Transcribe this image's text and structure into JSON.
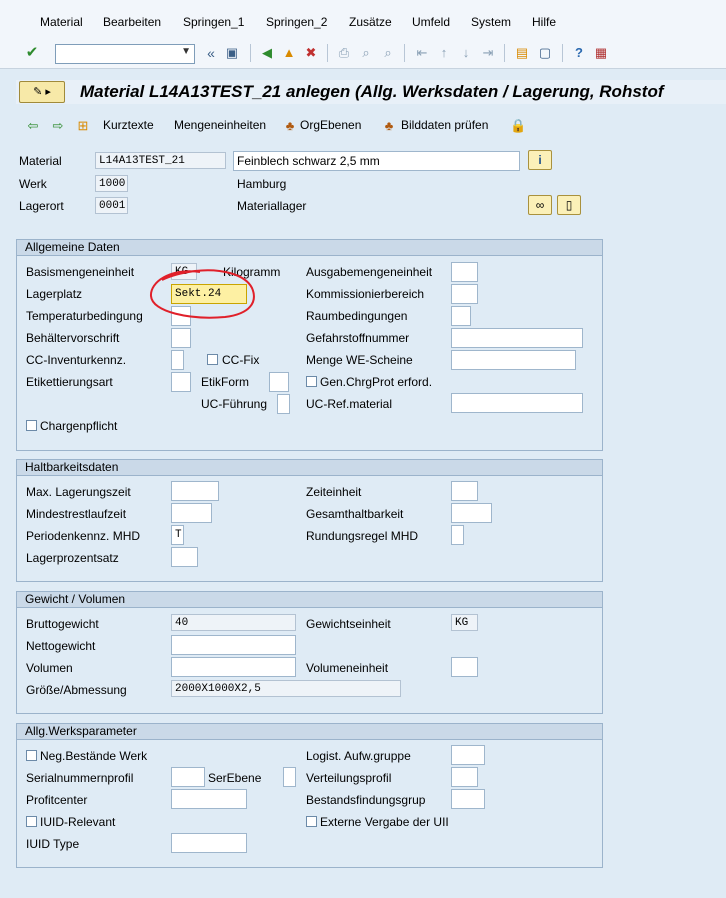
{
  "menu": [
    "Material",
    "Bearbeiten",
    "Springen_1",
    "Springen_2",
    "Zusätze",
    "Umfeld",
    "System",
    "Hilfe"
  ],
  "command_field": {
    "value": ""
  },
  "title": "Material L14A13TEST_21 anlegen (Allg. Werksdaten / Lagerung, Rohstof",
  "app_toolbar": {
    "kurztexte": "Kurztexte",
    "mengeneinheiten": "Mengeneinheiten",
    "orgebenen": "OrgEbenen",
    "bilddaten": "Bilddaten prüfen"
  },
  "header": {
    "material_label": "Material",
    "material_value": "L14A13TEST_21",
    "material_desc": "Feinblech schwarz 2,5 mm",
    "werk_label": "Werk",
    "werk_value": "1000",
    "werk_name": "Hamburg",
    "lagerort_label": "Lagerort",
    "lagerort_value": "0001",
    "lagerort_name": "Materiallager"
  },
  "allgemeine_daten": {
    "title": "Allgemeine Daten",
    "basismengeneinheit": "Basismengeneinheit",
    "basis_value": "KG",
    "basis_text": "Kilogramm",
    "lagerplatz": "Lagerplatz",
    "lagerplatz_value": "Sekt.24",
    "temperaturbedingung": "Temperaturbedingung",
    "behaeltervorschrift": "Behältervorschrift",
    "cc_inventur": "CC-Inventurkennz.",
    "cc_fix": "CC-Fix",
    "etikettierungsart": "Etikettierungsart",
    "etikform": "EtikForm",
    "uc_fuehrung": "UC-Führung",
    "chargenpflicht": "Chargenpflicht",
    "ausgabemengeneinheit": "Ausgabemengeneinheit",
    "kommissionierbereich": "Kommissionierbereich",
    "raumbedingungen": "Raumbedingungen",
    "gefahrstoffnummer": "Gefahrstoffnummer",
    "menge_we": "Menge WE-Scheine",
    "gen_chrg": "Gen.ChrgProt erford.",
    "uc_ref": "UC-Ref.material"
  },
  "haltbarkeit": {
    "title": "Haltbarkeitsdaten",
    "max_lagerungszeit": "Max. Lagerungszeit",
    "mindestrestlaufzeit": "Mindestrestlaufzeit",
    "periodenkennz": "Periodenkennz. MHD",
    "periodenkennz_value": "T",
    "lagerprozentsatz": "Lagerprozentsatz",
    "zeiteinheit": "Zeiteinheit",
    "gesamthaltbarkeit": "Gesamthaltbarkeit",
    "rundungsregel": "Rundungsregel MHD"
  },
  "gewicht": {
    "title": "Gewicht / Volumen",
    "brutto": "Bruttogewicht",
    "brutto_value": "40",
    "netto": "Nettogewicht",
    "volumen": "Volumen",
    "groesse": "Größe/Abmessung",
    "groesse_value": "2000X1000X2,5",
    "gewichtseinheit": "Gewichtseinheit",
    "gewichtseinheit_value": "KG",
    "volumeneinheit": "Volumeneinheit"
  },
  "werksparameter": {
    "title": "Allg.Werksparameter",
    "neg_bestaende": "Neg.Bestände Werk",
    "serialnummernprofil": "Serialnummernprofil",
    "serebene": "SerEbene",
    "profitcenter": "Profitcenter",
    "iuid_relevant": "IUID-Relevant",
    "iuid_type": "IUID Type",
    "logist": "Logist. Aufw.gruppe",
    "verteilungsprofil": "Verteilungsprofil",
    "bestandsfindung": "Bestandsfindungsgrup",
    "externe_vergabe": "Externe Vergabe der UII"
  },
  "colors": {
    "background": "#dfebf5",
    "focus_field": "#fdf0a3",
    "annotation": "#e0202a"
  }
}
